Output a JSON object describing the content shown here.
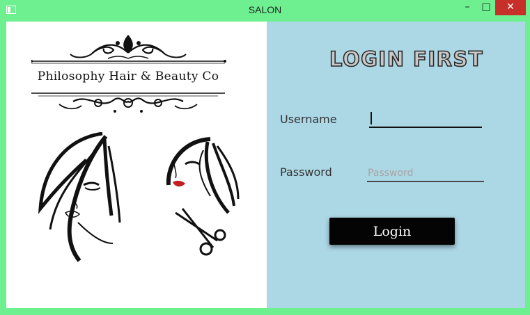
{
  "window": {
    "title": "SALON",
    "minimize_label": "–",
    "maximize_label": "□",
    "close_label": "✕"
  },
  "brand": {
    "name": "Philosophy Hair & Beauty Co"
  },
  "login": {
    "heading": "LOGIN FIRST",
    "username_label": "Username",
    "username_value": "",
    "password_label": "Password",
    "password_placeholder": "Password",
    "button_label": "Login"
  },
  "colors": {
    "frame": "#6ef090",
    "right_panel": "#acd7e5",
    "close_button": "#c7302a",
    "login_button": "#040404"
  }
}
